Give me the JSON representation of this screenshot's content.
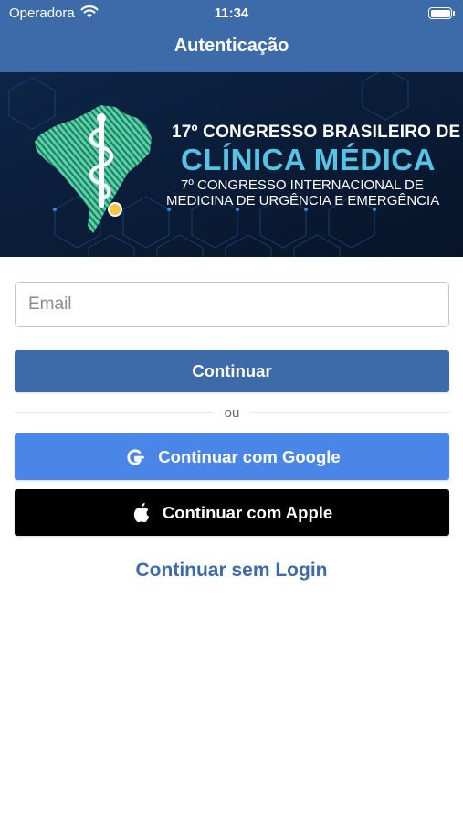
{
  "status_bar": {
    "carrier": "Operadora",
    "time": "11:34"
  },
  "nav": {
    "title": "Autenticação"
  },
  "banner": {
    "line1": "17º CONGRESSO BRASILEIRO DE",
    "line2": "CLÍNICA MÉDICA",
    "line3": "7º CONGRESSO INTERNACIONAL DE",
    "line4": "MEDICINA DE URGÊNCIA E EMERGÊNCIA"
  },
  "form": {
    "email_placeholder": "Email",
    "email_value": "",
    "continue_label": "Continuar",
    "divider_label": "ou",
    "google_label": "Continuar com Google",
    "apple_label": "Continuar com Apple",
    "no_login_label": "Continuar sem Login"
  },
  "icons": {
    "wifi": "wifi-icon",
    "battery": "battery-icon",
    "google": "google-g-icon",
    "apple": "apple-logo-icon",
    "logo": "brazil-map-caduceus-logo"
  },
  "colors": {
    "primary": "#3d6aa8",
    "google": "#4a86e8",
    "apple": "#000000",
    "banner_bg": "#0a1d3a",
    "banner_accent": "#56c2e4",
    "map_green": "#4fc69a"
  }
}
